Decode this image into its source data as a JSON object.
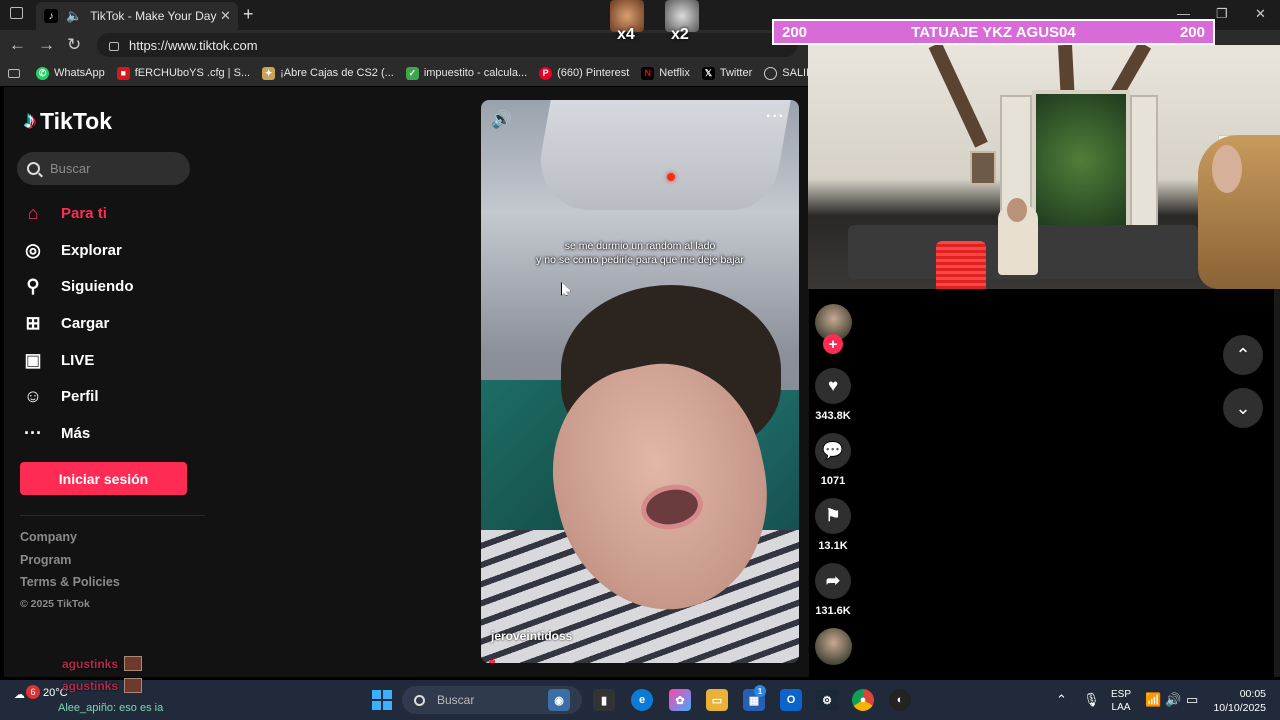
{
  "browser": {
    "tab_title": "TikTok - Make Your Day",
    "url": "https://www.tiktok.com",
    "bookmarks": [
      {
        "label": "WhatsApp",
        "icon": "whatsapp-icon",
        "color": "#25d366"
      },
      {
        "label": "fERCHUboYS .cfg | S...",
        "icon": "red-square-icon",
        "color": "#d41a1a"
      },
      {
        "label": "¡Abre Cajas de CS2 (...",
        "icon": "gift-icon",
        "color": "#c9a35a"
      },
      {
        "label": "impuestito - calcula...",
        "icon": "green-chart-icon",
        "color": "#3aa84b"
      },
      {
        "label": "(660) Pinterest",
        "icon": "pinterest-icon",
        "color": "#e60023"
      },
      {
        "label": "Netflix",
        "icon": "netflix-icon",
        "color": "#b20710"
      },
      {
        "label": "Twitter",
        "icon": "x-icon",
        "color": "#000000"
      },
      {
        "label": "SALIMOS READ",
        "icon": "globe-icon",
        "color": "#444444"
      }
    ]
  },
  "overlay": {
    "emote1_count": "x4",
    "emote2_count": "x2",
    "banner_left": "200",
    "banner_title": "TATUAJE YKZ AGUS04",
    "banner_right": "200",
    "chat": [
      {
        "user": "agustinks"
      },
      {
        "user": "agustinks"
      }
    ],
    "chat_sub": "Alee_apiño: eso es ia"
  },
  "tiktok": {
    "logo": "TikTok",
    "search_placeholder": "Buscar",
    "menu": [
      {
        "label": "Para ti",
        "icon": "home-icon"
      },
      {
        "label": "Explorar",
        "icon": "compass-icon"
      },
      {
        "label": "Siguiendo",
        "icon": "following-icon"
      },
      {
        "label": "Cargar",
        "icon": "upload-icon"
      },
      {
        "label": "LIVE",
        "icon": "live-icon"
      },
      {
        "label": "Perfil",
        "icon": "profile-icon"
      },
      {
        "label": "Más",
        "icon": "more-icon"
      }
    ],
    "login_label": "Iniciar sesión",
    "footer": [
      "Company",
      "Program",
      "Terms & Policies"
    ],
    "copyright": "© 2025 TikTok",
    "video": {
      "caption_line1": "se me durmio un random al lado",
      "caption_line2": "y no se como pedirle para que me deje bajar",
      "username": "jeroveintidoss"
    },
    "actions": {
      "likes": "343.8K",
      "comments": "1071",
      "saves": "13.1K",
      "shares": "131.6K"
    }
  },
  "taskbar": {
    "notif_count": "6",
    "temperature": "20°C",
    "search_placeholder": "Buscar",
    "lang_line1": "ESP",
    "lang_line2": "LAA",
    "time": "00:05",
    "date": "10/10/2025",
    "store_badge": "1"
  }
}
